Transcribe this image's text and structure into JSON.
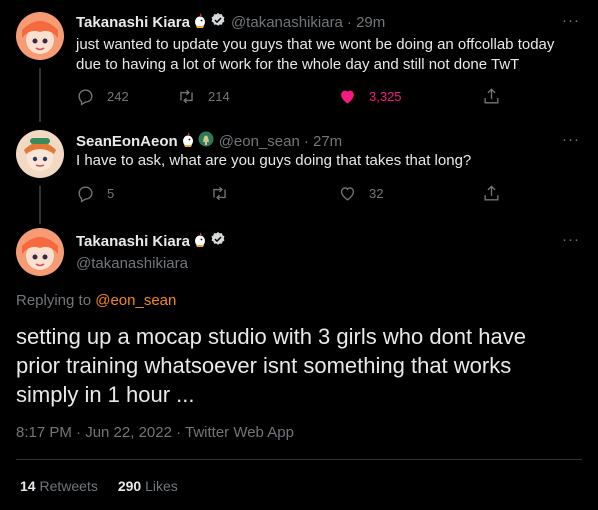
{
  "tweets": [
    {
      "name": "Takanashi Kiara",
      "handle": "@takanashikiara",
      "time": "· 29m",
      "text": "just wanted to update you guys that we wont be doing an offcollab today due to having a lot of work for the whole day and still not done TwT",
      "replies": "242",
      "retweets": "214",
      "likes": "3,325"
    },
    {
      "name": "SeanEonAeon",
      "handle": "@eon_sean",
      "time": "· 27m",
      "text": "I have to ask, what are you guys doing that takes that long?",
      "replies": "5",
      "retweets": "",
      "likes": "32"
    }
  ],
  "main": {
    "name": "Takanashi Kiara",
    "handle": "@takanashikiara",
    "replying_prefix": "Replying to",
    "replying_handle": "@eon_sean",
    "text": "setting up a mocap studio with 3 girls who dont have prior training whatsoever isnt something that works simply in 1 hour ...",
    "timestamp": "8:17 PM · Jun 22, 2022 · Twitter Web App",
    "retweets_count": "14",
    "retweets_label": "Retweets",
    "likes_count": "290",
    "likes_label": "Likes"
  },
  "more_label": "···",
  "colors": {
    "background": "#000000",
    "text": "#e7e9ea",
    "secondary": "#71767b",
    "like": "#f91880",
    "mention": "#f4871e"
  }
}
